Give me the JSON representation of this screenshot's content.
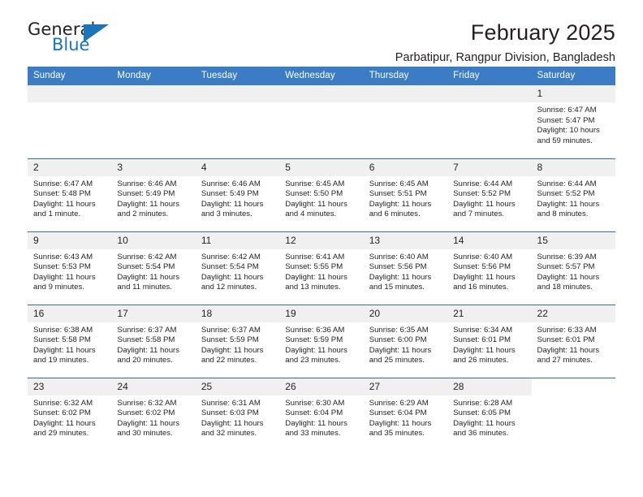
{
  "brand": {
    "name_primary": "General",
    "name_secondary": "Blue",
    "triangle_color": "#1b75bb"
  },
  "header": {
    "title": "February 2025",
    "location": "Parbatipur, Rangpur Division, Bangladesh"
  },
  "theme": {
    "header_bg": "#3b7cc4",
    "row_border": "#2f6cb3",
    "daynum_bg": "#f0f0f0",
    "text": "#231f20"
  },
  "weekdays": [
    "Sunday",
    "Monday",
    "Tuesday",
    "Wednesday",
    "Thursday",
    "Friday",
    "Saturday"
  ],
  "labels": {
    "sunrise": "Sunrise:",
    "sunset": "Sunset:",
    "daylight": "Daylight:"
  },
  "weeks": [
    [
      {
        "empty": true
      },
      {
        "empty": true
      },
      {
        "empty": true
      },
      {
        "empty": true
      },
      {
        "empty": true
      },
      {
        "empty": true
      },
      {
        "day": "1",
        "sunrise": "Sunrise: 6:47 AM",
        "sunset": "Sunset: 5:47 PM",
        "daylight_line1": "Daylight: 10 hours",
        "daylight_line2": "and 59 minutes."
      }
    ],
    [
      {
        "day": "2",
        "sunrise": "Sunrise: 6:47 AM",
        "sunset": "Sunset: 5:48 PM",
        "daylight_line1": "Daylight: 11 hours",
        "daylight_line2": "and 1 minute."
      },
      {
        "day": "3",
        "sunrise": "Sunrise: 6:46 AM",
        "sunset": "Sunset: 5:49 PM",
        "daylight_line1": "Daylight: 11 hours",
        "daylight_line2": "and 2 minutes."
      },
      {
        "day": "4",
        "sunrise": "Sunrise: 6:46 AM",
        "sunset": "Sunset: 5:49 PM",
        "daylight_line1": "Daylight: 11 hours",
        "daylight_line2": "and 3 minutes."
      },
      {
        "day": "5",
        "sunrise": "Sunrise: 6:45 AM",
        "sunset": "Sunset: 5:50 PM",
        "daylight_line1": "Daylight: 11 hours",
        "daylight_line2": "and 4 minutes."
      },
      {
        "day": "6",
        "sunrise": "Sunrise: 6:45 AM",
        "sunset": "Sunset: 5:51 PM",
        "daylight_line1": "Daylight: 11 hours",
        "daylight_line2": "and 6 minutes."
      },
      {
        "day": "7",
        "sunrise": "Sunrise: 6:44 AM",
        "sunset": "Sunset: 5:52 PM",
        "daylight_line1": "Daylight: 11 hours",
        "daylight_line2": "and 7 minutes."
      },
      {
        "day": "8",
        "sunrise": "Sunrise: 6:44 AM",
        "sunset": "Sunset: 5:52 PM",
        "daylight_line1": "Daylight: 11 hours",
        "daylight_line2": "and 8 minutes."
      }
    ],
    [
      {
        "day": "9",
        "sunrise": "Sunrise: 6:43 AM",
        "sunset": "Sunset: 5:53 PM",
        "daylight_line1": "Daylight: 11 hours",
        "daylight_line2": "and 9 minutes."
      },
      {
        "day": "10",
        "sunrise": "Sunrise: 6:42 AM",
        "sunset": "Sunset: 5:54 PM",
        "daylight_line1": "Daylight: 11 hours",
        "daylight_line2": "and 11 minutes."
      },
      {
        "day": "11",
        "sunrise": "Sunrise: 6:42 AM",
        "sunset": "Sunset: 5:54 PM",
        "daylight_line1": "Daylight: 11 hours",
        "daylight_line2": "and 12 minutes."
      },
      {
        "day": "12",
        "sunrise": "Sunrise: 6:41 AM",
        "sunset": "Sunset: 5:55 PM",
        "daylight_line1": "Daylight: 11 hours",
        "daylight_line2": "and 13 minutes."
      },
      {
        "day": "13",
        "sunrise": "Sunrise: 6:40 AM",
        "sunset": "Sunset: 5:56 PM",
        "daylight_line1": "Daylight: 11 hours",
        "daylight_line2": "and 15 minutes."
      },
      {
        "day": "14",
        "sunrise": "Sunrise: 6:40 AM",
        "sunset": "Sunset: 5:56 PM",
        "daylight_line1": "Daylight: 11 hours",
        "daylight_line2": "and 16 minutes."
      },
      {
        "day": "15",
        "sunrise": "Sunrise: 6:39 AM",
        "sunset": "Sunset: 5:57 PM",
        "daylight_line1": "Daylight: 11 hours",
        "daylight_line2": "and 18 minutes."
      }
    ],
    [
      {
        "day": "16",
        "sunrise": "Sunrise: 6:38 AM",
        "sunset": "Sunset: 5:58 PM",
        "daylight_line1": "Daylight: 11 hours",
        "daylight_line2": "and 19 minutes."
      },
      {
        "day": "17",
        "sunrise": "Sunrise: 6:37 AM",
        "sunset": "Sunset: 5:58 PM",
        "daylight_line1": "Daylight: 11 hours",
        "daylight_line2": "and 20 minutes."
      },
      {
        "day": "18",
        "sunrise": "Sunrise: 6:37 AM",
        "sunset": "Sunset: 5:59 PM",
        "daylight_line1": "Daylight: 11 hours",
        "daylight_line2": "and 22 minutes."
      },
      {
        "day": "19",
        "sunrise": "Sunrise: 6:36 AM",
        "sunset": "Sunset: 5:59 PM",
        "daylight_line1": "Daylight: 11 hours",
        "daylight_line2": "and 23 minutes."
      },
      {
        "day": "20",
        "sunrise": "Sunrise: 6:35 AM",
        "sunset": "Sunset: 6:00 PM",
        "daylight_line1": "Daylight: 11 hours",
        "daylight_line2": "and 25 minutes."
      },
      {
        "day": "21",
        "sunrise": "Sunrise: 6:34 AM",
        "sunset": "Sunset: 6:01 PM",
        "daylight_line1": "Daylight: 11 hours",
        "daylight_line2": "and 26 minutes."
      },
      {
        "day": "22",
        "sunrise": "Sunrise: 6:33 AM",
        "sunset": "Sunset: 6:01 PM",
        "daylight_line1": "Daylight: 11 hours",
        "daylight_line2": "and 27 minutes."
      }
    ],
    [
      {
        "day": "23",
        "sunrise": "Sunrise: 6:32 AM",
        "sunset": "Sunset: 6:02 PM",
        "daylight_line1": "Daylight: 11 hours",
        "daylight_line2": "and 29 minutes."
      },
      {
        "day": "24",
        "sunrise": "Sunrise: 6:32 AM",
        "sunset": "Sunset: 6:02 PM",
        "daylight_line1": "Daylight: 11 hours",
        "daylight_line2": "and 30 minutes."
      },
      {
        "day": "25",
        "sunrise": "Sunrise: 6:31 AM",
        "sunset": "Sunset: 6:03 PM",
        "daylight_line1": "Daylight: 11 hours",
        "daylight_line2": "and 32 minutes."
      },
      {
        "day": "26",
        "sunrise": "Sunrise: 6:30 AM",
        "sunset": "Sunset: 6:04 PM",
        "daylight_line1": "Daylight: 11 hours",
        "daylight_line2": "and 33 minutes."
      },
      {
        "day": "27",
        "sunrise": "Sunrise: 6:29 AM",
        "sunset": "Sunset: 6:04 PM",
        "daylight_line1": "Daylight: 11 hours",
        "daylight_line2": "and 35 minutes."
      },
      {
        "day": "28",
        "sunrise": "Sunrise: 6:28 AM",
        "sunset": "Sunset: 6:05 PM",
        "daylight_line1": "Daylight: 11 hours",
        "daylight_line2": "and 36 minutes."
      },
      {
        "blank": true
      }
    ]
  ]
}
